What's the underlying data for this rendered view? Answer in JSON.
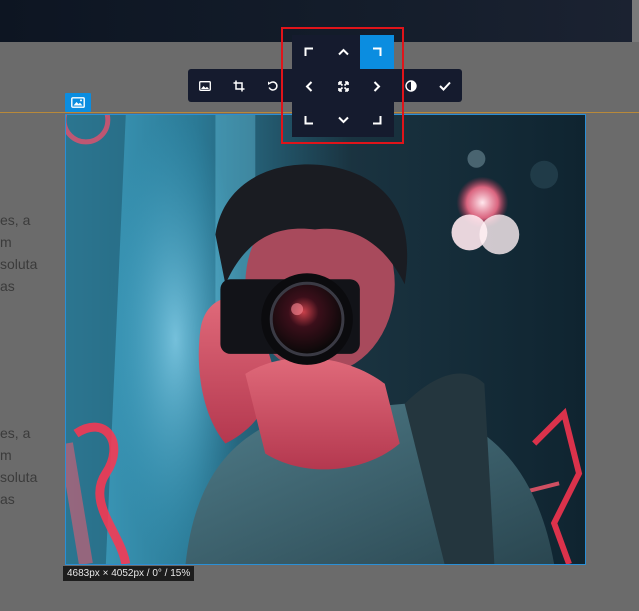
{
  "page": {
    "paragraph_1": [
      "es, a",
      "m",
      "soluta",
      "as"
    ],
    "paragraph_2": [
      "es, a",
      "m",
      "soluta",
      "as"
    ]
  },
  "image": {
    "dimensions_label": "4683px × 4052px / 0° / 15%",
    "badge_icon": "image-icon"
  },
  "toolbar": {
    "buttons": [
      {
        "name": "replace-image",
        "icon": "image-icon"
      },
      {
        "name": "crop",
        "icon": "crop-icon"
      },
      {
        "name": "rotate",
        "icon": "rotate-icon"
      },
      {
        "name": "filter",
        "icon": "contrast-icon"
      },
      {
        "name": "apply",
        "icon": "check-icon"
      }
    ]
  },
  "position_grid": {
    "active": "top-right",
    "cells": [
      "top-left",
      "top",
      "top-right",
      "left",
      "center",
      "right",
      "bottom-left",
      "bottom",
      "bottom-right"
    ]
  },
  "colors": {
    "accent": "#0b8de0",
    "toolbar_bg": "#151b2e",
    "highlight": "#e0141a",
    "guide_line": "#b8893a"
  }
}
